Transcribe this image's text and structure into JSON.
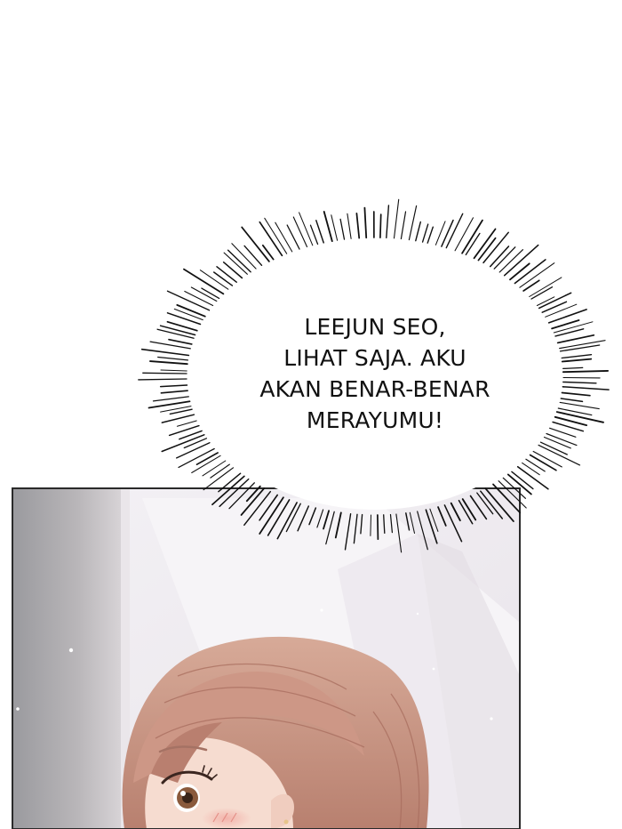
{
  "bubble": {
    "lines": [
      "LEEJUN SEO,",
      "LIHAT SAJA. AKU",
      "AKAN BENAR-BENAR",
      "MERAYUMU!"
    ]
  },
  "colors": {
    "background": "#ffffff",
    "panel_border": "#2a2a2a",
    "hair": "#c99a8a",
    "skin": "#f4d9cc"
  }
}
